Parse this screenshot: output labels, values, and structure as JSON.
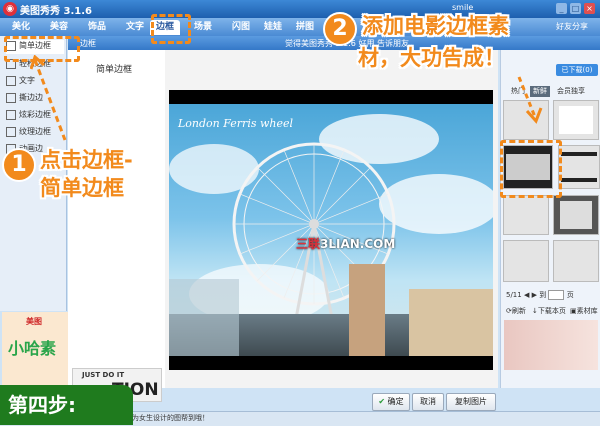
{
  "window": {
    "title": "美图秀秀 3.1.6",
    "user": "smile",
    "controls": [
      "_",
      "□",
      "×"
    ]
  },
  "tabs": [
    {
      "label": "美化"
    },
    {
      "label": "美容"
    },
    {
      "label": "饰品"
    },
    {
      "label": "文字"
    },
    {
      "label": "边框"
    },
    {
      "label": "场景"
    },
    {
      "label": "闪图"
    },
    {
      "label": "娃娃"
    },
    {
      "label": "拼图"
    }
  ],
  "share_label": "好友分享",
  "sidebar": {
    "items": [
      {
        "label": "简单边框"
      },
      {
        "label": "轻松边框"
      },
      {
        "label": "文字"
      },
      {
        "label": "撕边边"
      },
      {
        "label": "炫彩边框"
      },
      {
        "label": "纹理边框"
      },
      {
        "label": "动画边"
      }
    ],
    "ad_logo": "美图",
    "ad_text": "小哈素"
  },
  "panel": {
    "header_title": "边框",
    "header_notice": "觉得美图秀秀 3.1.6 好用 告诉朋友",
    "label": "简单边框",
    "promo_small": "JUST DO IT",
    "promo_big": "TION"
  },
  "canvas": {
    "caption": "London Ferris wheel",
    "watermark_prefix": "三联",
    "watermark_rest": "3LIAN.COM"
  },
  "buttons": {
    "confirm": "确定",
    "cancel": "取消",
    "copy": "复制图片"
  },
  "right_panel": {
    "download": "已下载(0)",
    "tabs": [
      {
        "label": "热门"
      },
      {
        "label": "新鲜"
      },
      {
        "label": "会员独享"
      }
    ],
    "page_current": "5/11",
    "page_goto": "到",
    "page_unit": "页",
    "refresh": "刷新",
    "download_more": "下载本页",
    "library": "素材库"
  },
  "status": {
    "text": "册上传图，专为女生设计的图帮到哦！"
  },
  "annotations": {
    "step1_number": "1",
    "step1_line1": "点击边框-",
    "step1_line2": "简单边框",
    "step2_number": "2",
    "step2_line1": "添加电影边框素",
    "step2_line2": "材，大功告成！",
    "badge": "第四步:"
  },
  "colors": {
    "accent": "#f28a1c",
    "badge": "#1f7b1e",
    "title_bar": "#1d5fae"
  }
}
